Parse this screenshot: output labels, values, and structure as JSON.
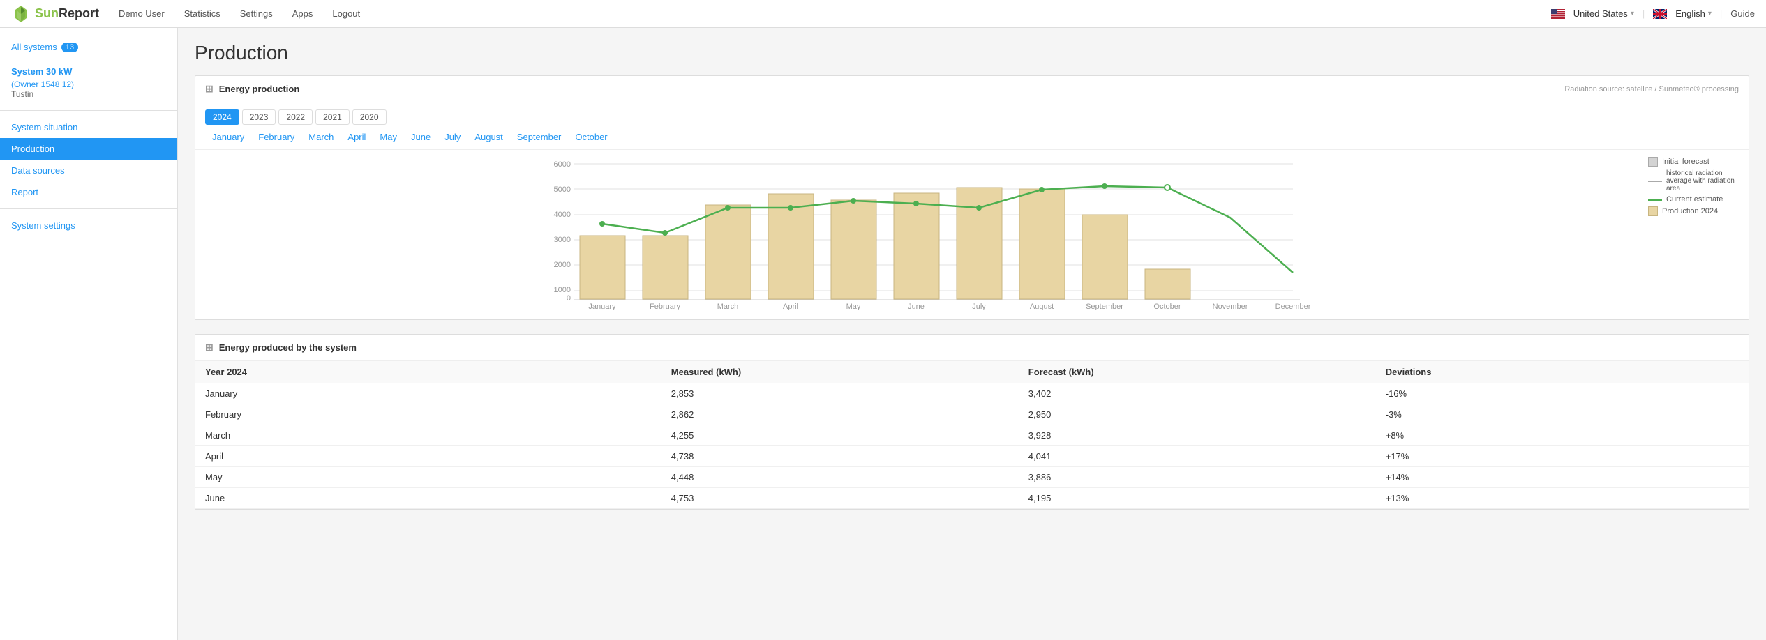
{
  "topnav": {
    "logo_text": "SunReport",
    "nav_items": [
      {
        "label": "Demo User"
      },
      {
        "label": "Statistics"
      },
      {
        "label": "Settings"
      },
      {
        "label": "Apps"
      },
      {
        "label": "Logout"
      }
    ],
    "country": "United States",
    "language": "English",
    "guide": "Guide"
  },
  "sidebar": {
    "all_systems_label": "All systems",
    "all_systems_count": "13",
    "system_name": "System 30 kW",
    "system_owner": "(Owner 1548 12)",
    "system_location": "Tustin",
    "nav_items": [
      {
        "label": "System situation",
        "active": false,
        "key": "system-situation"
      },
      {
        "label": "Production",
        "active": true,
        "key": "production"
      },
      {
        "label": "Data sources",
        "active": false,
        "key": "data-sources"
      },
      {
        "label": "Report",
        "active": false,
        "key": "report"
      }
    ],
    "system_settings_label": "System settings"
  },
  "main": {
    "page_title": "Production",
    "energy_production_card": {
      "title": "Energy production",
      "radiation_source": "Radiation source: satellite / Sunmeteo® processing",
      "year_tabs": [
        "2024",
        "2023",
        "2022",
        "2021",
        "2020"
      ],
      "active_year": "2024",
      "month_tabs": [
        "January",
        "February",
        "March",
        "April",
        "May",
        "June",
        "July",
        "August",
        "September",
        "October"
      ],
      "legend": [
        {
          "type": "box",
          "color": "#d3d3d3",
          "label": "Initial forecast"
        },
        {
          "type": "line",
          "color": "#aaa",
          "label": "historical radiation average with radiation area"
        },
        {
          "type": "line",
          "color": "#4caf50",
          "label": "Current estimate"
        },
        {
          "type": "box",
          "color": "#e8d5a3",
          "label": "Production 2024"
        }
      ],
      "chart": {
        "months": [
          "January",
          "February",
          "March",
          "April",
          "May",
          "June",
          "July",
          "August",
          "September",
          "October",
          "November",
          "December"
        ],
        "bars": [
          2853,
          2862,
          4255,
          4738,
          4448,
          4753,
          5000,
          4950,
          3800,
          1350,
          0,
          0
        ],
        "forecast_line": [
          3350,
          3000,
          4100,
          4100,
          4300,
          4200,
          4100,
          4700,
          4900,
          4950,
          3700,
          1200
        ],
        "ymax": 6000
      }
    },
    "energy_table_card": {
      "title": "Energy produced by the system",
      "col_year": "Year 2024",
      "col_measured": "Measured (kWh)",
      "col_forecast": "Forecast (kWh)",
      "col_deviations": "Deviations",
      "rows": [
        {
          "month": "January",
          "measured": "2,853",
          "forecast": "3,402",
          "deviation": "-16%",
          "dev_type": "neg"
        },
        {
          "month": "February",
          "measured": "2,862",
          "forecast": "2,950",
          "deviation": "-3%",
          "dev_type": "neg"
        },
        {
          "month": "March",
          "measured": "4,255",
          "forecast": "3,928",
          "deviation": "+8%",
          "dev_type": "pos"
        },
        {
          "month": "April",
          "measured": "4,738",
          "forecast": "4,041",
          "deviation": "+17%",
          "dev_type": "pos"
        },
        {
          "month": "May",
          "measured": "4,448",
          "forecast": "3,886",
          "deviation": "+14%",
          "dev_type": "pos"
        },
        {
          "month": "June",
          "measured": "4,753",
          "forecast": "4,195",
          "deviation": "+13%",
          "dev_type": "pos"
        }
      ]
    }
  }
}
